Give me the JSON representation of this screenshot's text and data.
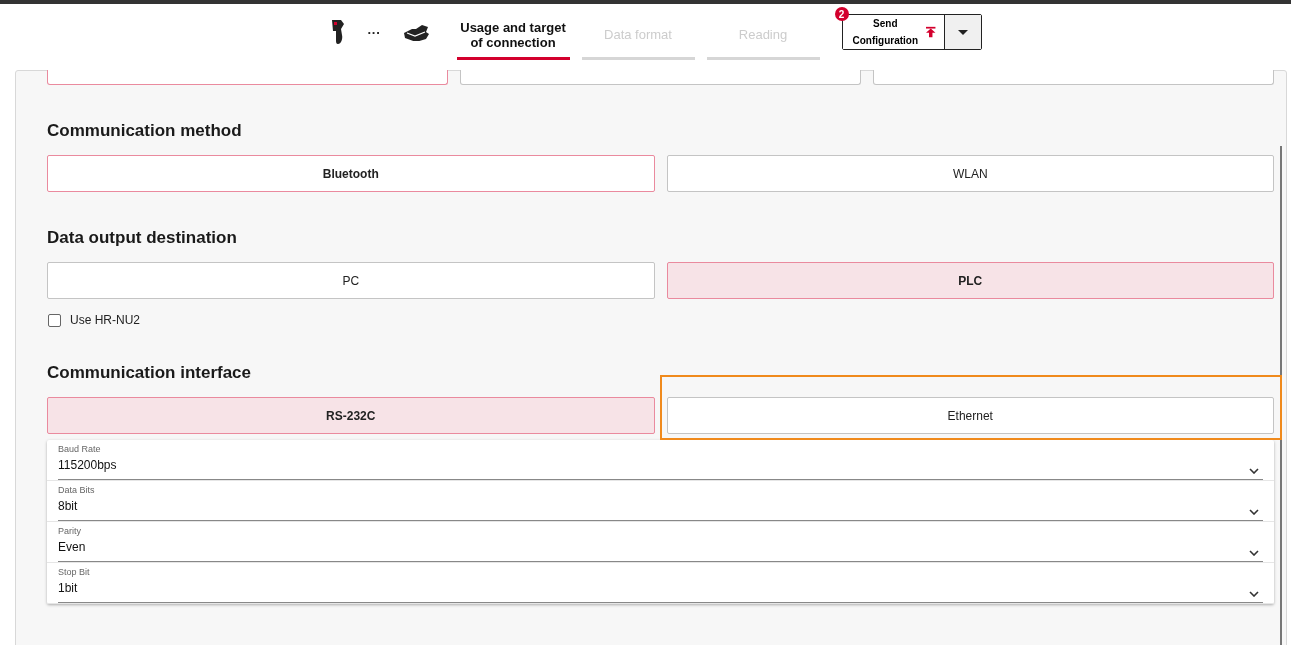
{
  "stepper": {
    "steps": [
      {
        "label": "Usage and target of connection",
        "selected": true
      },
      {
        "label": "Data format",
        "selected": false
      },
      {
        "label": "Reading",
        "selected": false
      }
    ],
    "more": "···"
  },
  "send_button": {
    "label": "Send Configuration",
    "badge": "2"
  },
  "sections": [
    {
      "kind": "outlined",
      "options": [
        {
          "selected": true
        },
        {
          "selected": false
        },
        {
          "selected": false
        }
      ]
    },
    {
      "title": "Communication method",
      "kind": "outlined",
      "options": [
        {
          "label": "Bluetooth",
          "selected": true
        },
        {
          "label": "WLAN",
          "selected": false
        }
      ]
    },
    {
      "title": "Data output destination",
      "kind": "filled",
      "options": [
        {
          "label": "PC",
          "selected": false
        },
        {
          "label": "PLC",
          "selected": true
        }
      ],
      "checkbox": {
        "label": "Use HR-NU2",
        "checked": false
      }
    },
    {
      "title": "Communication interface",
      "kind": "filled",
      "options": [
        {
          "label": "RS-232C",
          "selected": true
        },
        {
          "label": "Ethernet",
          "selected": false,
          "highlighted": true
        }
      ],
      "fields": [
        {
          "label": "Baud Rate",
          "value": "115200bps"
        },
        {
          "label": "Data Bits",
          "value": "8bit"
        },
        {
          "label": "Parity",
          "value": "Even"
        },
        {
          "label": "Stop Bit",
          "value": "1bit"
        }
      ]
    }
  ]
}
